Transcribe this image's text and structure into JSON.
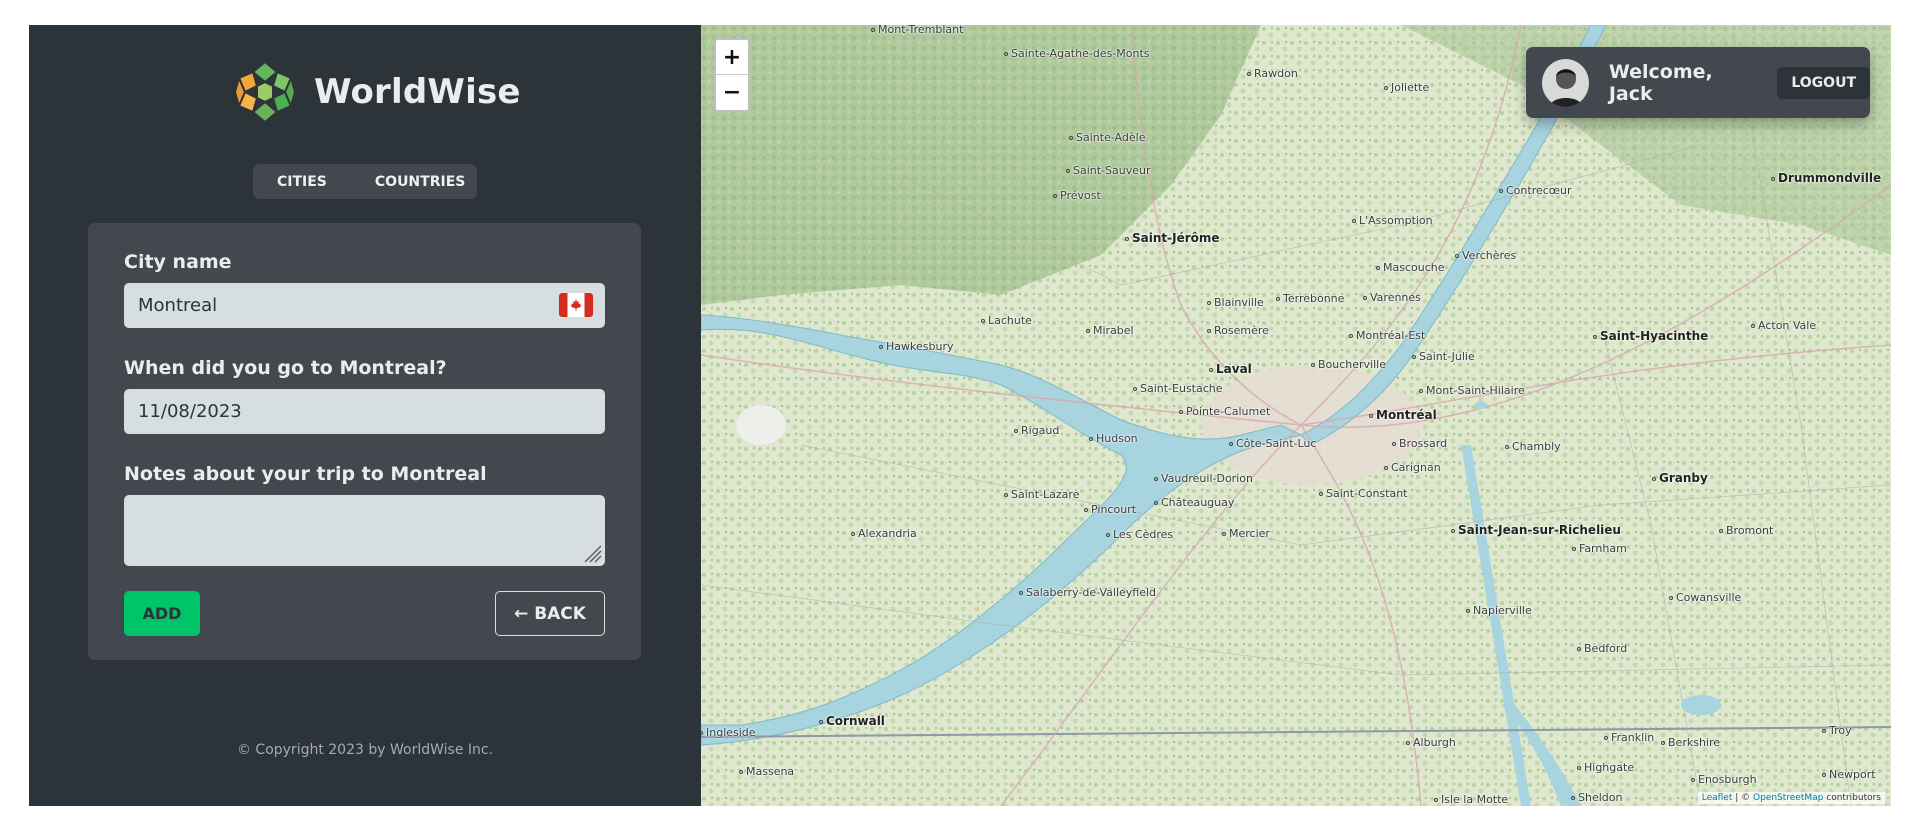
{
  "brand": {
    "name": "WorldWise"
  },
  "nav": {
    "tabs": [
      {
        "label": "Cities"
      },
      {
        "label": "Countries"
      }
    ]
  },
  "form": {
    "city_label": "City name",
    "city_value": "Montreal",
    "date_label": "When did you go to Montreal?",
    "date_value": "11/08/2023",
    "notes_label": "Notes about your trip to Montreal",
    "notes_value": "",
    "add_label": "Add",
    "back_label": "← BACK",
    "flag": "🇨🇦"
  },
  "footer": {
    "text": "© Copyright 2023 by WorldWise Inc."
  },
  "user": {
    "welcome": "Welcome, Jack",
    "logout_label": "Logout"
  },
  "map": {
    "zoom_in": "+",
    "zoom_out": "−",
    "attribution": {
      "leaflet": "Leaflet",
      "sep": " | © ",
      "osm": "OpenStreetMap",
      "tail": " contributors"
    },
    "places": [
      "Mont-Tremblant",
      "Sainte-Agathe-des-Monts",
      "Rawdon",
      "Joliette",
      "Sainte-Adèle",
      "Saint-Sauveur",
      "Prévost",
      "Saint-Jérôme",
      "L'Assomption",
      "Contrecœur",
      "Mascouche",
      "Verchères",
      "Drummondville",
      "Lachute",
      "Mirabel",
      "Blainville",
      "Terrebonne",
      "Varennes",
      "Rosemère",
      "Montréal-Est",
      "Hawkesbury",
      "Laval",
      "Boucherville",
      "Saint-Julie",
      "Saint-Hyacinthe",
      "Acton Vale",
      "Saint-Eustache",
      "Mont-Saint-Hilaire",
      "Pointe-Calumet",
      "Montréal",
      "Rigaud",
      "Hudson",
      "Côte-Saint-Luc",
      "Brossard",
      "Chambly",
      "Vaudreuil-Dorion",
      "Carignan",
      "Saint-Lazare",
      "Pincourt",
      "Châteauguay",
      "Saint-Constant",
      "Granby",
      "Saint-Jean-sur-Richelieu",
      "Alexandria",
      "Les Cèdres",
      "Mercier",
      "Bromont",
      "Farnham",
      "Salaberry-de-Valleyfield",
      "Cowansville",
      "Napierville",
      "Bedford",
      "Cornwall",
      "Ingleside",
      "Alburgh",
      "Franklin",
      "Berkshire",
      "Troy",
      "Highgate",
      "Massena",
      "Enosburgh",
      "Newport",
      "Sheldon",
      "Isle la Motte"
    ]
  }
}
